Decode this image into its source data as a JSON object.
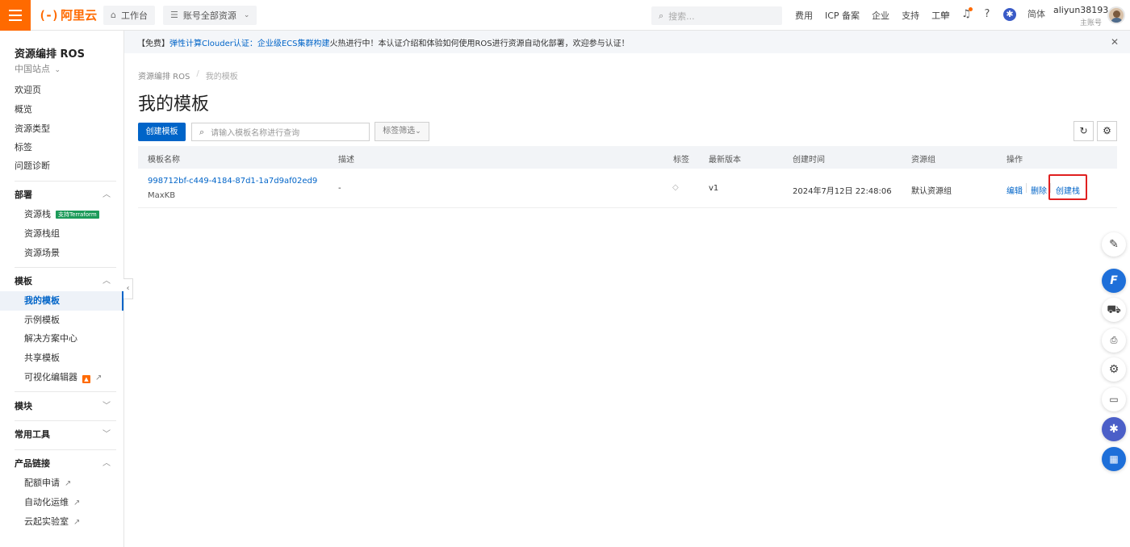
{
  "topbar": {
    "logo_text": "阿里云",
    "logo_mark": "(-)",
    "workbench_label": "工作台",
    "resource_label": "账号全部资源",
    "search_placeholder": "搜索...",
    "nav": [
      "费用",
      "ICP 备案",
      "企业",
      "支持",
      "工单"
    ],
    "lang": "简体",
    "user_name": "aliyun38193...",
    "user_role": "主账号"
  },
  "sidebar": {
    "title": "资源编排 ROS",
    "region": "中国站点",
    "top_items": [
      "欢迎页",
      "概览",
      "资源类型",
      "标签",
      "问题诊断"
    ],
    "groups": {
      "deploy": "部署",
      "template": "模板",
      "module": "模块",
      "tools": "常用工具",
      "links": "产品链接"
    },
    "deploy_items": [
      "资源栈",
      "资源栈组",
      "资源场景"
    ],
    "terraform_badge": "支持Terraform",
    "template_items": [
      "我的模板",
      "示例模板",
      "解决方案中心",
      "共享模板",
      "可视化编辑器"
    ],
    "link_items": [
      "配额申请",
      "自动化运维",
      "云起实验室"
    ]
  },
  "banner": {
    "prefix": "【免费】",
    "link1": "弹性计算Clouder认证：",
    "link2": "企业级ECS集群构建",
    "rest": "火热进行中！本认证介绍和体验如何使用ROS进行资源自动化部署，欢迎参与认证！"
  },
  "breadcrumb": [
    "资源编排 ROS",
    "我的模板"
  ],
  "page_title": "我的模板",
  "toolbar": {
    "create_label": "创建模板",
    "search_placeholder": "请输入模板名称进行查询",
    "tag_filter_label": "标签筛选"
  },
  "table": {
    "headers": [
      "模板名称",
      "描述",
      "标签",
      "最新版本",
      "创建时间",
      "资源组",
      "操作"
    ],
    "rows": [
      {
        "id": "998712bf-c449-4184-87d1-1a7d9af02ed9",
        "name": "MaxKB",
        "description": "-",
        "version": "v1",
        "created": "2024年7月12日 22:48:06",
        "resource_group": "默认资源组",
        "actions": [
          "编辑",
          "删除",
          "创建栈"
        ]
      }
    ]
  },
  "colors": {
    "brand_orange": "#ff6a00",
    "primary_blue": "#0064c8",
    "highlight_red": "#e02020"
  },
  "icons": {
    "float_tools": [
      "edit-icon",
      "f-app-icon",
      "cart-icon",
      "app-icon",
      "settings-icon",
      "chat-icon",
      "star-app-icon",
      "grid-apps-icon"
    ]
  }
}
